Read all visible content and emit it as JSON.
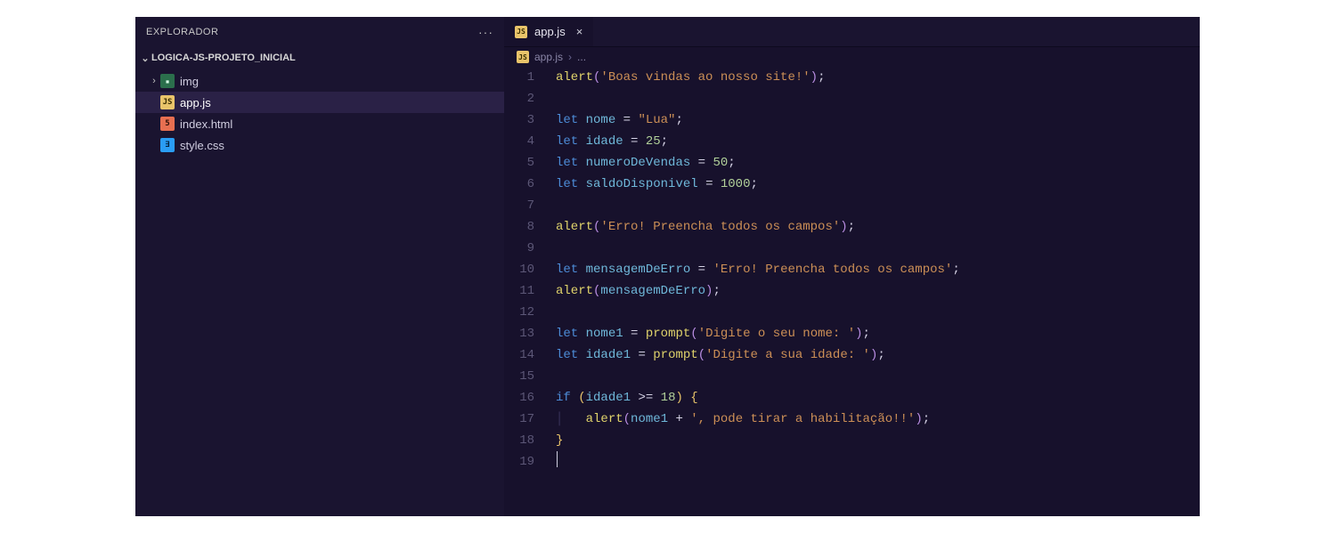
{
  "sidebar": {
    "title": "EXPLORADOR",
    "project": "LOGICA-JS-PROJETO_INICIAL",
    "items": [
      {
        "icon": "folder",
        "label": "img",
        "chev": "›",
        "selected": false
      },
      {
        "icon": "js",
        "label": "app.js",
        "chev": "",
        "selected": true
      },
      {
        "icon": "html",
        "label": "index.html",
        "chev": "",
        "selected": false
      },
      {
        "icon": "css",
        "label": "style.css",
        "chev": "",
        "selected": false
      }
    ]
  },
  "tabs": {
    "active": {
      "icon": "js",
      "label": "app.js"
    }
  },
  "breadcrumbs": {
    "file": "app.js",
    "sep": "›",
    "tail": "..."
  },
  "file_icons": {
    "folder": "▪",
    "js": "JS",
    "html": "5",
    "css": "∃"
  },
  "code": {
    "lines": [
      [
        [
          "fn",
          "alert"
        ],
        [
          "br",
          "("
        ],
        [
          "str",
          "'Boas vindas ao nosso site!'"
        ],
        [
          "br",
          ")"
        ],
        [
          "punc",
          ";"
        ]
      ],
      [],
      [
        [
          "kw",
          "let"
        ],
        [
          "plain",
          " "
        ],
        [
          "var",
          "nome"
        ],
        [
          "plain",
          " "
        ],
        [
          "op",
          "="
        ],
        [
          "plain",
          " "
        ],
        [
          "str",
          "\"Lua\""
        ],
        [
          "punc",
          ";"
        ]
      ],
      [
        [
          "kw",
          "let"
        ],
        [
          "plain",
          " "
        ],
        [
          "var",
          "idade"
        ],
        [
          "plain",
          " "
        ],
        [
          "op",
          "="
        ],
        [
          "plain",
          " "
        ],
        [
          "num",
          "25"
        ],
        [
          "punc",
          ";"
        ]
      ],
      [
        [
          "kw",
          "let"
        ],
        [
          "plain",
          " "
        ],
        [
          "var",
          "numeroDeVendas"
        ],
        [
          "plain",
          " "
        ],
        [
          "op",
          "="
        ],
        [
          "plain",
          " "
        ],
        [
          "num",
          "50"
        ],
        [
          "punc",
          ";"
        ]
      ],
      [
        [
          "kw",
          "let"
        ],
        [
          "plain",
          " "
        ],
        [
          "var",
          "saldoDisponivel"
        ],
        [
          "plain",
          " "
        ],
        [
          "op",
          "="
        ],
        [
          "plain",
          " "
        ],
        [
          "num",
          "1000"
        ],
        [
          "punc",
          ";"
        ]
      ],
      [],
      [
        [
          "fn",
          "alert"
        ],
        [
          "br",
          "("
        ],
        [
          "str",
          "'Erro! Preencha todos os campos'"
        ],
        [
          "br",
          ")"
        ],
        [
          "punc",
          ";"
        ]
      ],
      [],
      [
        [
          "kw",
          "let"
        ],
        [
          "plain",
          " "
        ],
        [
          "var",
          "mensagemDeErro"
        ],
        [
          "plain",
          " "
        ],
        [
          "op",
          "="
        ],
        [
          "plain",
          " "
        ],
        [
          "str",
          "'Erro! Preencha todos os campos'"
        ],
        [
          "punc",
          ";"
        ]
      ],
      [
        [
          "fn",
          "alert"
        ],
        [
          "br",
          "("
        ],
        [
          "var",
          "mensagemDeErro"
        ],
        [
          "br",
          ")"
        ],
        [
          "punc",
          ";"
        ]
      ],
      [],
      [
        [
          "kw",
          "let"
        ],
        [
          "plain",
          " "
        ],
        [
          "var",
          "nome1"
        ],
        [
          "plain",
          " "
        ],
        [
          "op",
          "="
        ],
        [
          "plain",
          " "
        ],
        [
          "fn",
          "prompt"
        ],
        [
          "br",
          "("
        ],
        [
          "str",
          "'Digite o seu nome: '"
        ],
        [
          "br",
          ")"
        ],
        [
          "punc",
          ";"
        ]
      ],
      [
        [
          "kw",
          "let"
        ],
        [
          "plain",
          " "
        ],
        [
          "var",
          "idade1"
        ],
        [
          "plain",
          " "
        ],
        [
          "op",
          "="
        ],
        [
          "plain",
          " "
        ],
        [
          "fn",
          "prompt"
        ],
        [
          "br",
          "("
        ],
        [
          "str",
          "'Digite a sua idade: '"
        ],
        [
          "br",
          ")"
        ],
        [
          "punc",
          ";"
        ]
      ],
      [],
      [
        [
          "kw",
          "if"
        ],
        [
          "plain",
          " "
        ],
        [
          "br2",
          "("
        ],
        [
          "var",
          "idade1"
        ],
        [
          "plain",
          " "
        ],
        [
          "op",
          ">="
        ],
        [
          "plain",
          " "
        ],
        [
          "num",
          "18"
        ],
        [
          "br2",
          ")"
        ],
        [
          "plain",
          " "
        ],
        [
          "br2",
          "{"
        ]
      ],
      [
        [
          "plain",
          "    "
        ],
        [
          "fn",
          "alert"
        ],
        [
          "br",
          "("
        ],
        [
          "var",
          "nome1"
        ],
        [
          "plain",
          " "
        ],
        [
          "op",
          "+"
        ],
        [
          "plain",
          " "
        ],
        [
          "str",
          "', pode tirar a habilitação!!'"
        ],
        [
          "br",
          ")"
        ],
        [
          "punc",
          ";"
        ]
      ],
      [
        [
          "br2",
          "}"
        ]
      ],
      [
        [
          "cursor",
          ""
        ]
      ]
    ]
  }
}
